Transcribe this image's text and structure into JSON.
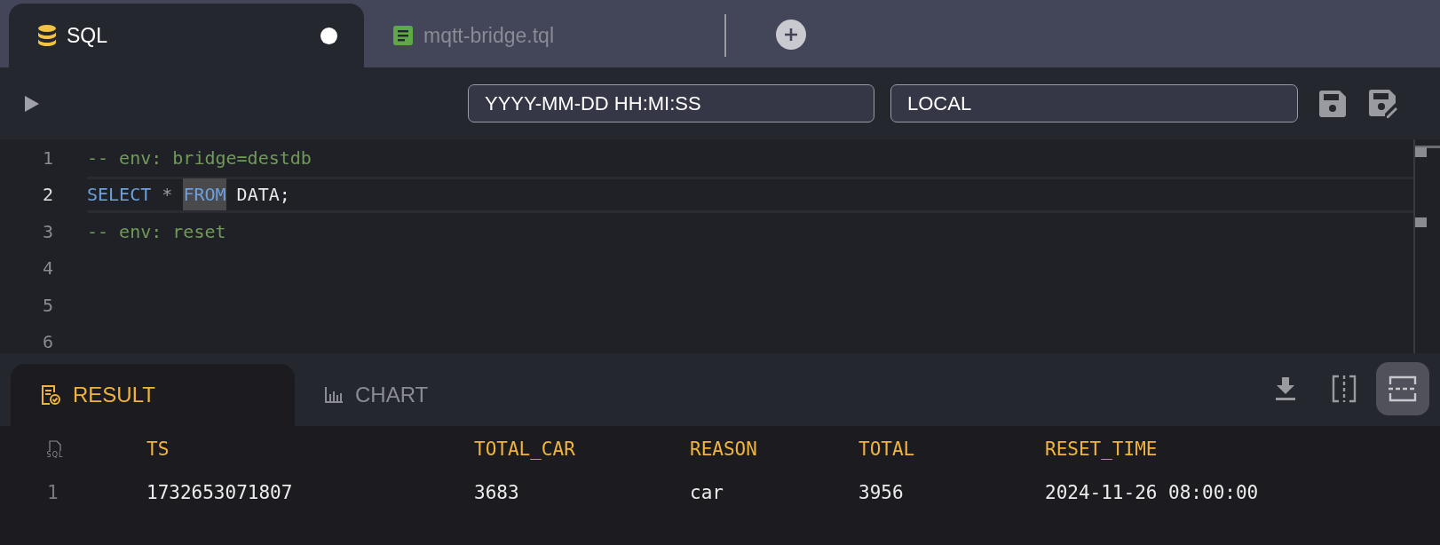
{
  "tabs": [
    {
      "kind": "sql",
      "label": "SQL",
      "selected": true,
      "modified": true
    },
    {
      "kind": "tql",
      "label": "mqtt-bridge.tql",
      "selected": false,
      "modified": false
    }
  ],
  "toolbar": {
    "time_format": "YYYY-MM-DD HH:MI:SS",
    "timezone": "LOCAL"
  },
  "editor": {
    "lines": [
      {
        "number": "1",
        "current": false,
        "tokens": [
          {
            "kind": "comment",
            "text": "-- env: bridge=destdb",
            "highlighted": false
          }
        ]
      },
      {
        "number": "2",
        "current": true,
        "tokens": [
          {
            "kind": "keyword",
            "text": "SELECT",
            "highlighted": false
          },
          {
            "kind": "operator",
            "text": " * ",
            "highlighted": false
          },
          {
            "kind": "keyword",
            "text": "FROM",
            "highlighted": true
          },
          {
            "kind": "plain",
            "text": " DATA;",
            "highlighted": false
          }
        ]
      },
      {
        "number": "3",
        "current": false,
        "tokens": [
          {
            "kind": "comment",
            "text": "-- env: reset",
            "highlighted": false
          }
        ]
      },
      {
        "number": "4",
        "current": false
      },
      {
        "number": "5",
        "current": false
      },
      {
        "number": "6",
        "current": false
      }
    ]
  },
  "result_tabs": [
    {
      "kind": "result",
      "label": "RESULT",
      "selected": true
    },
    {
      "kind": "chart",
      "label": "CHART",
      "selected": false
    }
  ],
  "layout_buttons": [
    {
      "kind": "vertical",
      "selected": false
    },
    {
      "kind": "horizontal",
      "selected": true
    }
  ],
  "table": {
    "corner_label": "SQL",
    "columns": [
      "TS",
      "TOTAL_CAR",
      "REASON",
      "TOTAL",
      "RESET_TIME"
    ],
    "rows": [
      {
        "number": "1",
        "cells": [
          "1732653071807",
          "3683",
          "car",
          "3956",
          "2024-11-26 08:00:00"
        ]
      }
    ]
  }
}
